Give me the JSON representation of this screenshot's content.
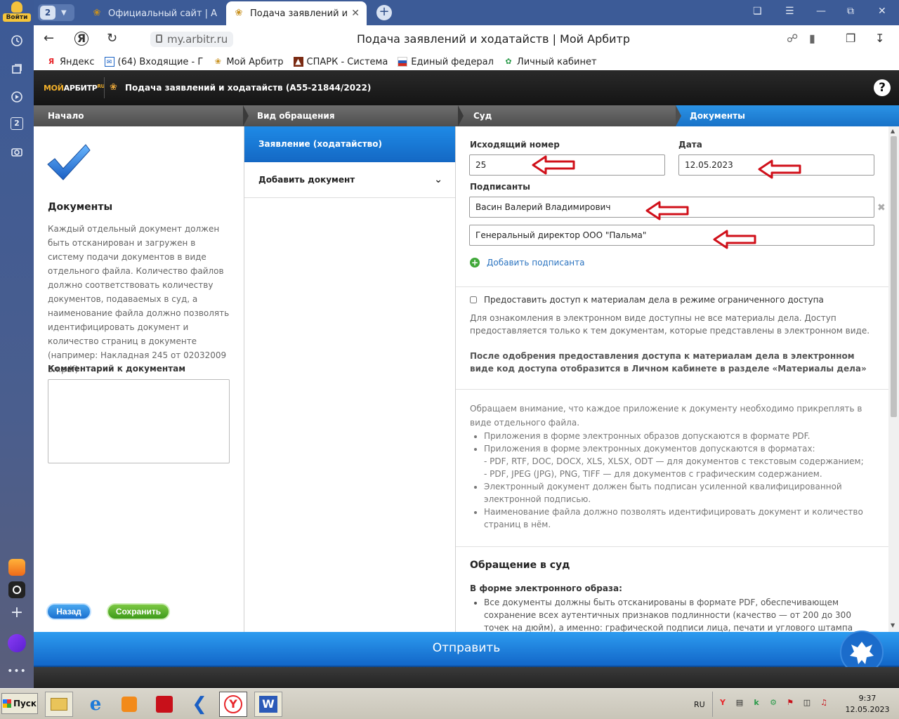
{
  "browser": {
    "login_label": "Войти",
    "tab_count": "2",
    "tabs": [
      {
        "title": "Официальный сайт | Арбитр"
      },
      {
        "title": "Подача заявлений и ходатайств"
      }
    ],
    "url": "my.arbitr.ru",
    "page_title": "Подача заявлений и ходатайств | Мой Арбитр",
    "sidebar_badge": "2",
    "bookmarks": [
      {
        "label": "Яндекс",
        "icon": "yandex-icon",
        "color": "#e8262b"
      },
      {
        "label": "(64) Входящие - Г",
        "icon": "mail-icon",
        "color": "#1a62c4"
      },
      {
        "label": "Мой Арбитр",
        "icon": "arbitr-icon",
        "color": "#c8911f"
      },
      {
        "label": "СПАРК - Система",
        "icon": "spark-icon",
        "color": "#c8341f"
      },
      {
        "label": "Единый федерал",
        "icon": "fed-icon",
        "color": "#2b5ab8"
      },
      {
        "label": "Личный кабинет",
        "icon": "cabinet-icon",
        "color": "#2b9a4a"
      }
    ]
  },
  "app": {
    "logo_moi": "МОЙ",
    "logo_arbitr": "АРБИТР",
    "logo_ru": "RU",
    "header_title": "Подача заявлений и ходатайств  (А55-21844/2022)",
    "help": "?",
    "steps": [
      "Начало",
      "Вид обращения",
      "Суд",
      "Документы"
    ],
    "active_step": 3
  },
  "left": {
    "heading": "Документы",
    "description": "Каждый отдельный документ должен быть отсканирован и загружен в систему подачи документов в виде отдельного файла. Количество файлов должно соответствовать количеству документов, подаваемых в суд, а наименование файла должно позволять идентифицировать документ и количество страниц в документе (например: Накладная 245 от 02032009 3л.pdf)",
    "comment_label": "Комментарий к документам",
    "back_label": "Назад",
    "save_label": "Сохранить"
  },
  "middle": {
    "active_item": "Заявление (ходатайство)",
    "add_document": "Добавить документ"
  },
  "form": {
    "outgoing_label": "Исходящий номер",
    "outgoing_value": "25",
    "date_label": "Дата",
    "date_value": "12.05.2023",
    "signers_label": "Подписанты",
    "signer_name": "Васин Валерий Владимирович",
    "signer_position": "Генеральный директор ООО \"Пальма\"",
    "add_signer": "Добавить подписанта",
    "restricted_access": "Предоставить доступ к материалам дела в режиме ограниченного доступа",
    "access_note": "Для ознакомления в электронном виде доступны не все материалы дела. Доступ предоставляется только к тем документам, которые представлены в электронном виде.",
    "access_bold": "После одобрения предоставления доступа к материалам дела в электронном виде код доступа отобразится в Личном кабинете в разделе «Материалы дела»",
    "attention": "Обращаем внимание, что каждое приложение к документу необходимо прикреплять в виде отдельного файла.",
    "rules": [
      "Приложения в форме электронных образов допускаются в формате PDF.",
      "Приложения в форме электронных документов допускаются в форматах:",
      "Электронный документ должен быть подписан усиленной квалифицированной электронной подписью.",
      "Наименование файла должно позволять идентифицировать документ и количество страниц в нём."
    ],
    "formats_text": "- PDF, RTF, DOC, DOCX, XLS, XLSX, ODT — для документов с текстовым содержанием;",
    "formats_graphic": "- PDF, JPEG (JPG), PNG, TIFF — для документов с графическим содержанием.",
    "court_heading": "Обращение в суд",
    "court_sub": "В форме электронного образа:",
    "court_item": "Все документы должны быть отсканированы в формате PDF, обеспечивающем сохранение всех аутентичных признаков подлинности (качество — от 200 до 300 точек на дюйм), а именно: графической подписи лица, печати и углового штампа бланка (при наличии)."
  },
  "send_label": "Отправить",
  "taskbar": {
    "start": "Пуск",
    "lang": "RU",
    "time": "9:37",
    "date": "12.05.2023"
  },
  "colors": {
    "accent_blue": "#1872c8",
    "save_green": "#3e9a1a",
    "annotation_red": "#d0101a"
  }
}
